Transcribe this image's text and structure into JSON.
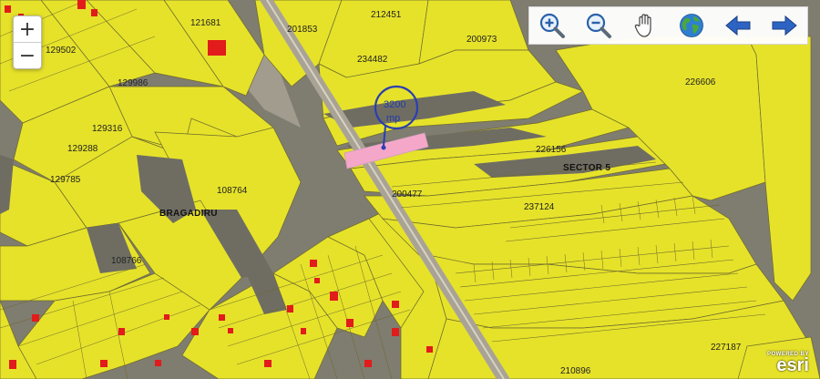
{
  "zoom": {
    "in_label": "+",
    "out_label": "−"
  },
  "toolbar": {
    "tools": [
      {
        "name": "zoom-in-tool-icon"
      },
      {
        "name": "zoom-out-tool-icon"
      },
      {
        "name": "pan-hand-icon"
      },
      {
        "name": "globe-full-extent-icon"
      },
      {
        "name": "back-arrow-icon"
      },
      {
        "name": "forward-arrow-icon"
      }
    ]
  },
  "map": {
    "colors": {
      "parcel_fill": "#e6e22a",
      "imagery": "#7f7c70",
      "highlight": "#f5a7c9",
      "marker": "#2a3fb0",
      "building": "#e21b1b"
    },
    "areas": [
      "BRAGADIRU",
      "SECTOR 5"
    ],
    "parcels": [
      "121681",
      "129502",
      "129986",
      "129316",
      "129288",
      "129785",
      "108764",
      "108766",
      "201853",
      "212451",
      "200973",
      "234482",
      "226606",
      "226156",
      "200477",
      "237124",
      "227187",
      "210896"
    ],
    "marker": {
      "line1": "3200",
      "line2": "mp"
    }
  },
  "attribution": {
    "powered": "POWERED BY",
    "name": "esri"
  }
}
